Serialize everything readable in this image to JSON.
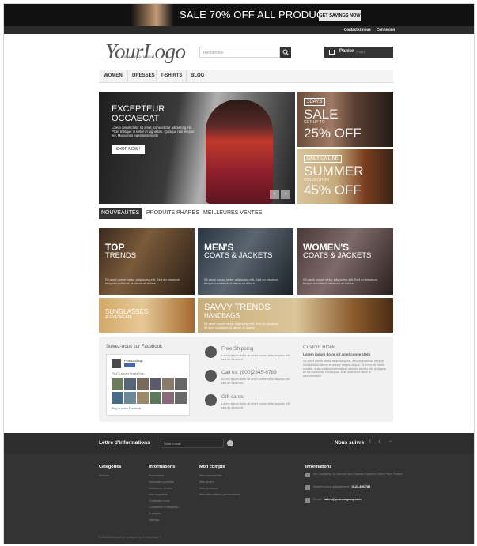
{
  "promo": {
    "text": "SALE 70% OFF ALL PRODUCTS",
    "button": "GET SAVINGS NOW"
  },
  "topnav": {
    "contact": "Contactez-nous",
    "login": "Connexion"
  },
  "logo": {
    "title": "YourLogo",
    "subtitle": "a new experience"
  },
  "search": {
    "placeholder": "Rechercher"
  },
  "cart": {
    "label": "Panier",
    "status": "(vide)"
  },
  "menu": [
    "WOMEN",
    "DRESSES",
    "T-SHIRTS",
    "BLOG"
  ],
  "slider": {
    "title_line1": "EXCEPTEUR",
    "title_line2": "OCCAECAT",
    "text": "Lorem ipsum dolor sit amet, consectetur adipiscing elit. Proin tristique in tortor et dignissim. Quisque non tempor leo. Maecenas egestas sem elit",
    "button": "SHOP NOW !",
    "prev": "‹",
    "next": "›"
  },
  "banner1": {
    "tag": "3DAYS",
    "big": "SALE",
    "small": "GET UP TO",
    "percent": "25% OFF"
  },
  "banner2": {
    "tag": "ONLY ONLINE",
    "big": "SUMMER",
    "small": "COLLECTION",
    "percent": "45% OFF"
  },
  "tabs": [
    "NOUVEAUTÉS",
    "PRODUITS PHARES",
    "MEILLEURES VENTES"
  ],
  "tiles": [
    {
      "title": "TOP",
      "subtitle": "TRENDS",
      "text": "Sit amet conse ctetur adipiscing elit. Sed do eiusmod tempor incididunt ut labore et dolore"
    },
    {
      "title": "MEN'S",
      "subtitle": "COATS & JACKETS",
      "text": "Sit amet conse ctetur adipiscing elit. Sed do eiusmod tempor incididunt ut labore et dolore"
    },
    {
      "title": "WOMEN'S",
      "subtitle": "COATS & JACKETS",
      "text": "Sit amet conse ctetur adipiscing elit. Sed do eiusmod tempor incididunt ut labore et dolore"
    }
  ],
  "wide1": {
    "title": "SUNGLASSES",
    "subtitle": "& EYEWEAR"
  },
  "wide2": {
    "title": "SAVVY TRENDS",
    "subtitle": "HANDBAGS",
    "text": "Sit amet conse ctetur adipiscing elit. Sed do eiusmod tempor incididunt ut labore et dolore"
  },
  "facebook": {
    "title": "Suivez-nous sur Facebook",
    "page": "PrestaShop",
    "count": "79,475 aiment PrestaShop",
    "plugin": "Plug-in social Facebook"
  },
  "features": [
    {
      "title": "Free Shipping",
      "text": "Lorem ipsum dolor sit amet conse ctetu adipisic elit sed do eiusmod."
    },
    {
      "title": "Call us: (800)2345-6789",
      "text": "Lorem ipsum dolor sit amet conse ctetu adipisic elit sed do eiusmod."
    },
    {
      "title": "Gift cards",
      "text": "Lorem ipsum dolor sit amet conse ctetu adipisic elit sed do eiusmod."
    }
  ],
  "custom": {
    "title": "Custom Block",
    "subtitle": "Lorem ipsum dolor sit amet conse ctetu",
    "text": "Sit amet conse ctetur adipisicing elit, sed do eiusmod tempor incididunt ut labore et dolore magna aliqua. Ut enim ad minim veniam, quis nostrud exercitation ullamco laboris nisi ut aliquip ex ea commodo consequat. Duis aute irure dolor in reprehenderit."
  },
  "newsletter": {
    "label": "Lettre d'informations",
    "placeholder": "Votre e-mail",
    "follow": "Nous suivre"
  },
  "footer": {
    "categories": {
      "title": "Catégories",
      "items": [
        "Women"
      ]
    },
    "informations": {
      "title": "Informations",
      "items": [
        "Promotions",
        "Nouveaux produits",
        "Meilleures ventes",
        "Nos magasins",
        "Contactez-nous",
        "Conditions d'utilisation",
        "À propos",
        "sitemap"
      ]
    },
    "account": {
      "title": "Mon compte",
      "items": [
        "Mes commandes",
        "Mes avoirs",
        "Mes adresses",
        "Mes informations personnelles"
      ]
    },
    "store": {
      "title": "Informations",
      "address": "My Company, 42 avenue des Champs Elysées 75000 Paris France",
      "phone_label": "Appelez-nous gratuitement :",
      "phone": "0123-456-789",
      "email_label": "E-mail :",
      "email": "sales@yourcompany.com"
    },
    "copyright": "© 2014 Ecommerce software by PrestaShop™"
  }
}
